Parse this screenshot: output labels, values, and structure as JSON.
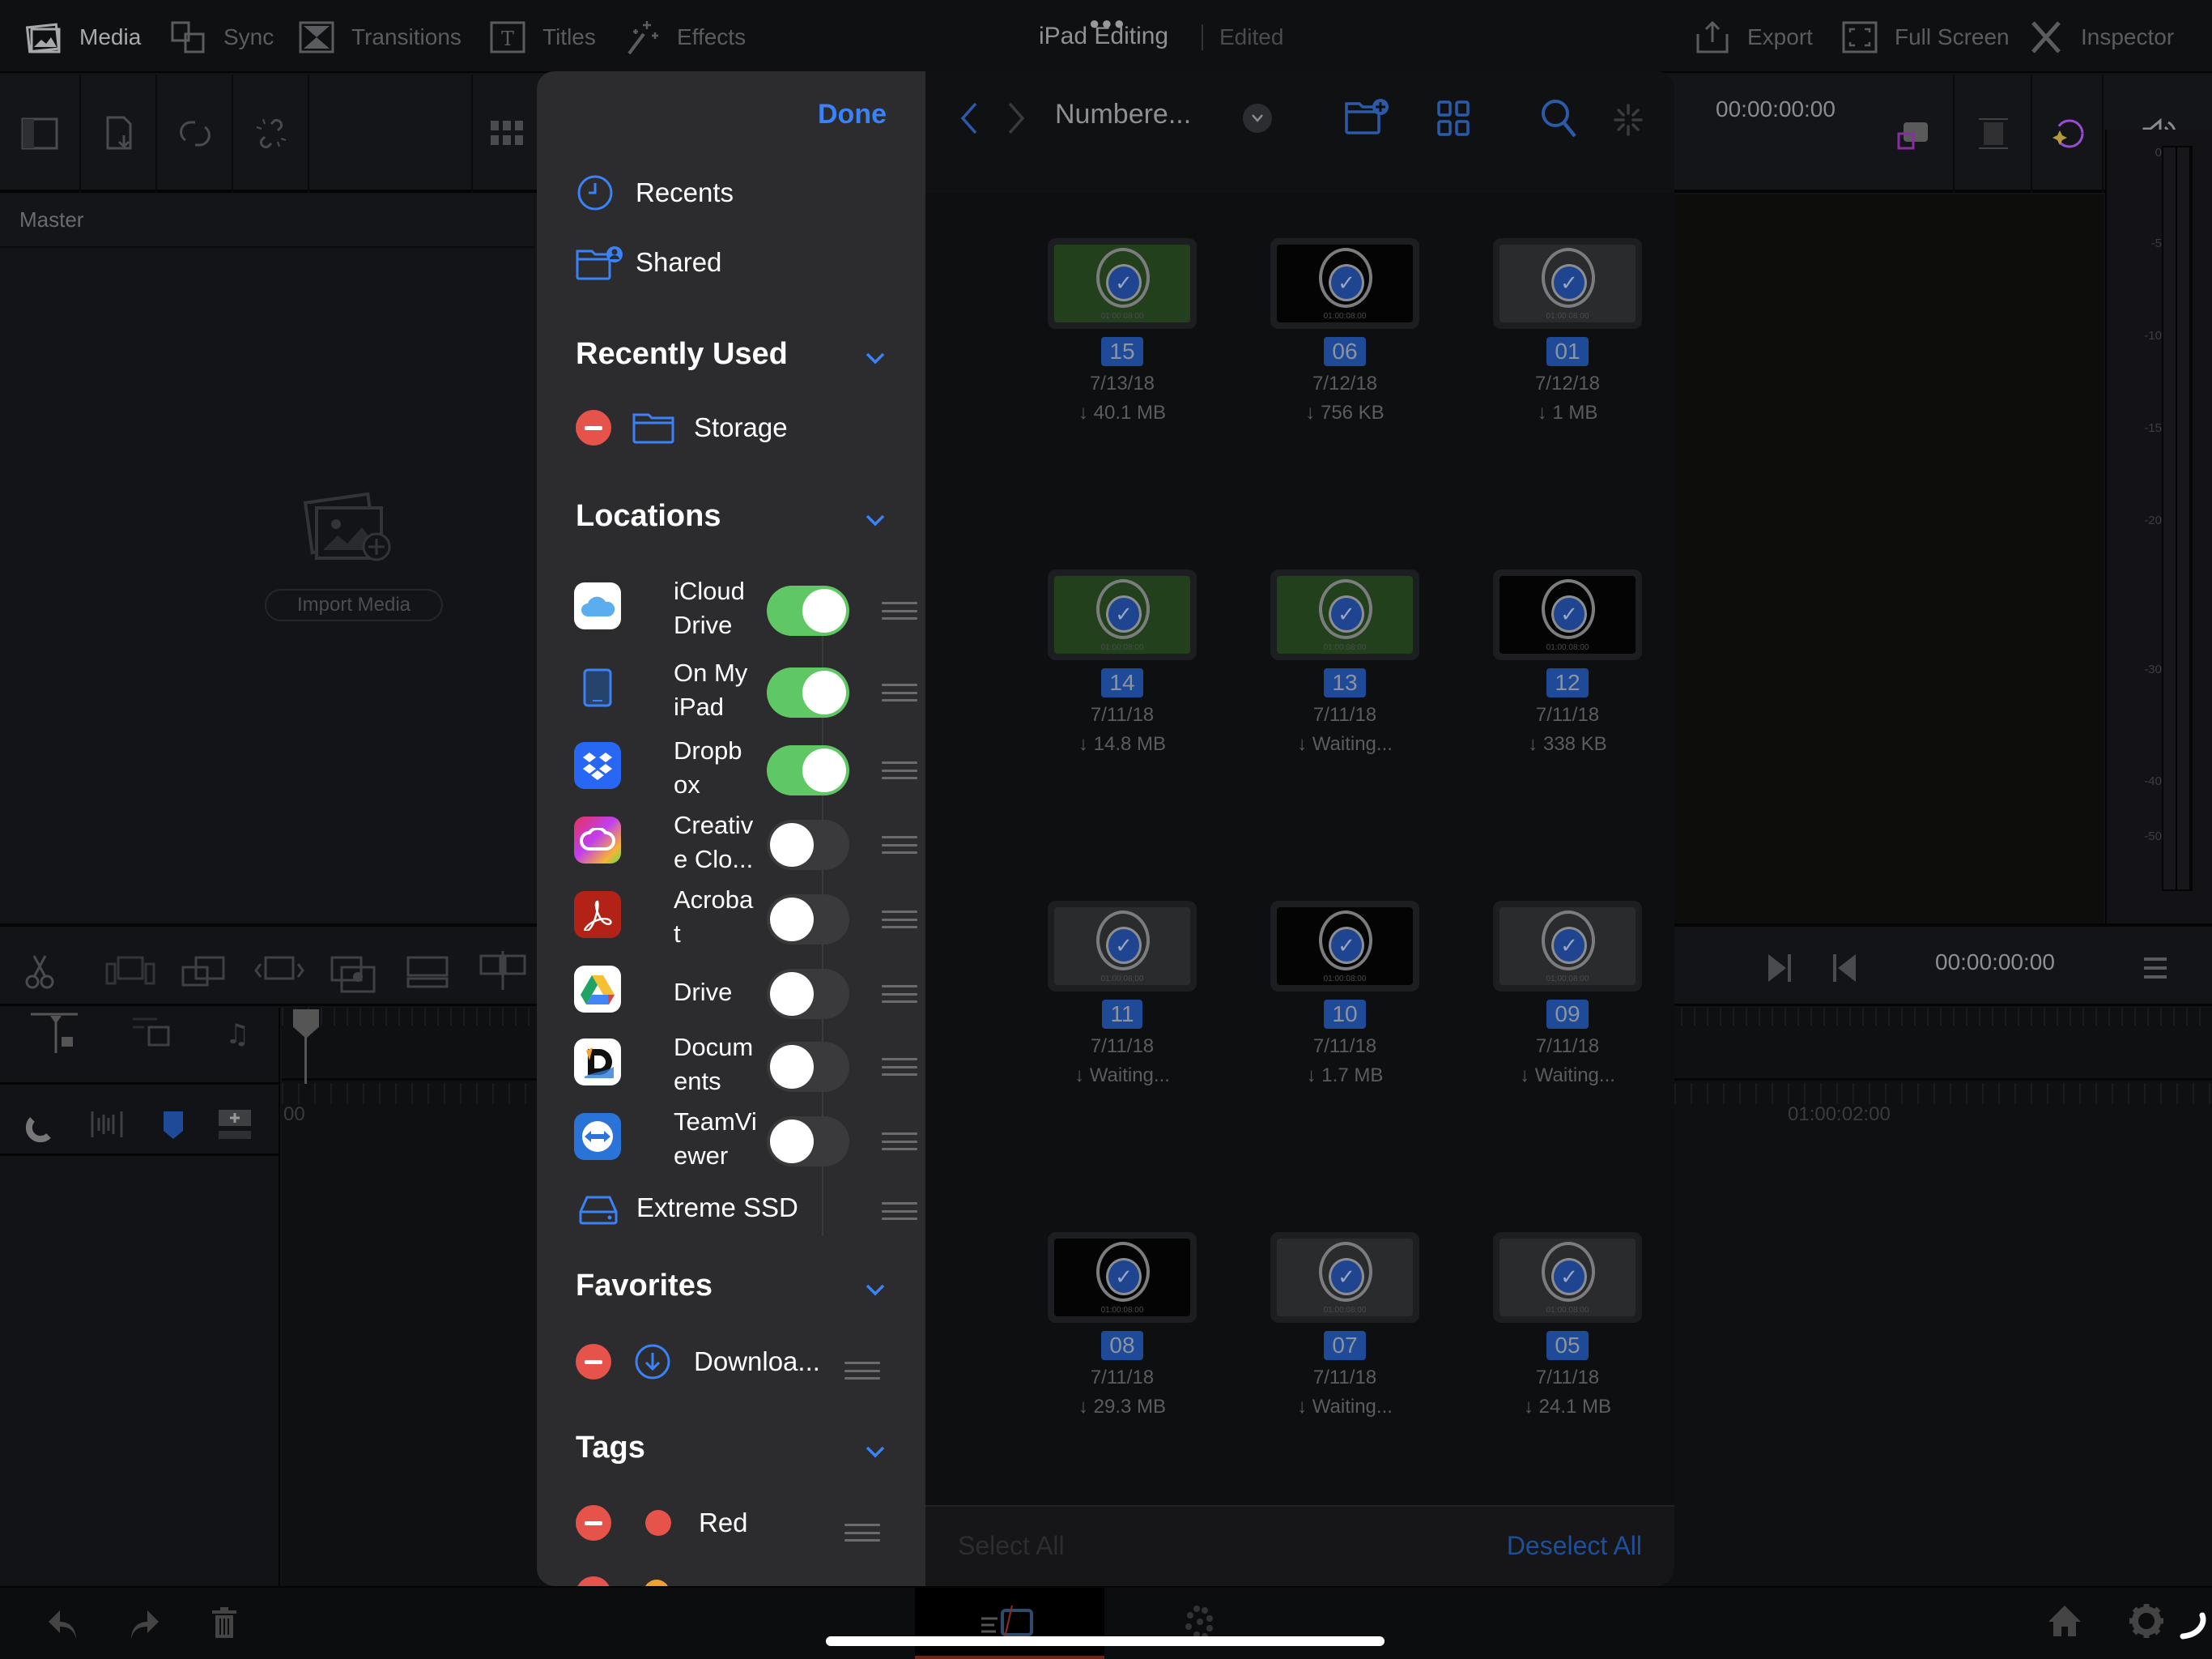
{
  "topbar": {
    "tabs": [
      {
        "label": "Media",
        "icon": "media-icon",
        "active": true
      },
      {
        "label": "Sync",
        "icon": "sync-icon",
        "active": false
      },
      {
        "label": "Transitions",
        "icon": "transitions-icon",
        "active": false
      },
      {
        "label": "Titles",
        "icon": "titles-icon",
        "active": false
      },
      {
        "label": "Effects",
        "icon": "effects-icon",
        "active": false
      }
    ],
    "project_title": "iPad Editing",
    "project_status": "Edited",
    "right_actions": [
      {
        "label": "Export",
        "icon": "export-icon"
      },
      {
        "label": "Full Screen",
        "icon": "fullscreen-icon"
      },
      {
        "label": "Inspector",
        "icon": "inspector-icon"
      }
    ]
  },
  "media_pool": {
    "bin_label": "Master",
    "import_label": "Import Media"
  },
  "viewer": {
    "timecode": "00:00:00:00"
  },
  "audio_meter": {
    "labels": [
      "0",
      "-5",
      "-10",
      "-15",
      "-20",
      "-30",
      "-40",
      "-50"
    ]
  },
  "timeline": {
    "timecode": "00:00:00:00",
    "ruler_start": "00",
    "ruler_mark": "01:00:02:00"
  },
  "file_picker": {
    "done_label": "Done",
    "top_items": [
      {
        "label": "Recents",
        "icon": "clock-icon"
      },
      {
        "label": "Shared",
        "icon": "shared-folder-icon"
      }
    ],
    "sections": {
      "recently_used": {
        "title": "Recently Used",
        "items": [
          {
            "label": "Storage",
            "icon": "folder-icon"
          }
        ]
      },
      "locations": {
        "title": "Locations",
        "items": [
          {
            "label": "iCloud Drive",
            "line1": "iCloud",
            "line2": "Drive",
            "enabled": true
          },
          {
            "label": "On My iPad",
            "line1": "On My",
            "line2": "iPad",
            "enabled": true
          },
          {
            "label": "Dropbox",
            "line1": "Dropb",
            "line2": "ox",
            "enabled": true
          },
          {
            "label": "Creative Cloud",
            "line1": "Creativ",
            "line2": "e Clo...",
            "enabled": false
          },
          {
            "label": "Acrobat",
            "line1": "Acroba",
            "line2": "t",
            "enabled": false
          },
          {
            "label": "Drive",
            "line1": "Drive",
            "line2": "",
            "enabled": false
          },
          {
            "label": "Documents",
            "line1": "Docum",
            "line2": "ents",
            "enabled": false
          },
          {
            "label": "TeamViewer",
            "line1": "TeamVi",
            "line2": "ewer",
            "enabled": false
          }
        ],
        "extra": "Extreme SSD"
      },
      "favorites": {
        "title": "Favorites",
        "items": [
          {
            "label": "Downloa...",
            "icon": "download-icon"
          }
        ]
      },
      "tags": {
        "title": "Tags",
        "items": [
          {
            "label": "Red",
            "color": "#e5534b"
          }
        ]
      }
    },
    "browser": {
      "folder_title": "Numbere...",
      "files": [
        {
          "name": "15",
          "date": "7/13/18",
          "size": "↓ 40.1 MB",
          "bg": "#22401c"
        },
        {
          "name": "06",
          "date": "7/12/18",
          "size": "↓ 756 KB",
          "bg": "#040404"
        },
        {
          "name": "01",
          "date": "7/12/18",
          "size": "↓ 1 MB",
          "bg": "#2a2b2d"
        },
        {
          "name": "14",
          "date": "7/11/18",
          "size": "↓ 14.8 MB",
          "bg": "#22401c"
        },
        {
          "name": "13",
          "date": "7/11/18",
          "size": "↓ Waiting...",
          "bg": "#22401c"
        },
        {
          "name": "12",
          "date": "7/11/18",
          "size": "↓ 338 KB",
          "bg": "#040404"
        },
        {
          "name": "11",
          "date": "7/11/18",
          "size": "↓ Waiting...",
          "bg": "#2a2b2d"
        },
        {
          "name": "10",
          "date": "7/11/18",
          "size": "↓ 1.7 MB",
          "bg": "#040404"
        },
        {
          "name": "09",
          "date": "7/11/18",
          "size": "↓ Waiting...",
          "bg": "#2a2b2d"
        },
        {
          "name": "08",
          "date": "7/11/18",
          "size": "↓ 29.3 MB",
          "bg": "#040404"
        },
        {
          "name": "07",
          "date": "7/11/18",
          "size": "↓ Waiting...",
          "bg": "#2a2b2d"
        },
        {
          "name": "05",
          "date": "7/11/18",
          "size": "↓ 24.1 MB",
          "bg": "#2a2b2d"
        }
      ],
      "thumb_timecode": "01:00:08:00",
      "select_all_label": "Select All",
      "deselect_all_label": "Deselect All"
    }
  },
  "colors": {
    "accent_blue": "#3b82f6",
    "toggle_on": "#5fc864",
    "remove_red": "#e5534b"
  }
}
